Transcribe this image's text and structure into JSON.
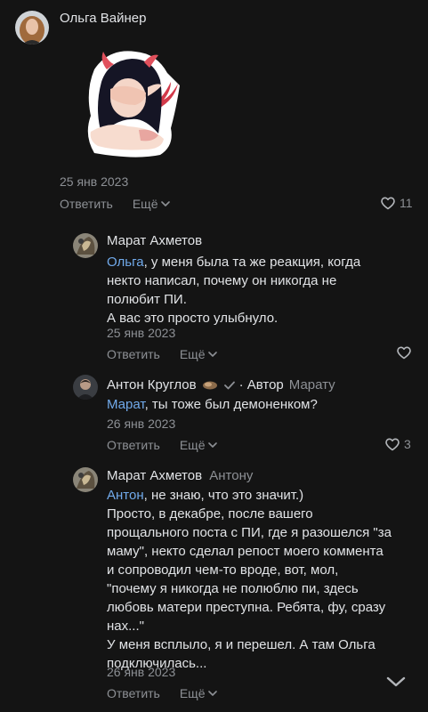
{
  "comments": [
    {
      "author": "Ольга Вайнер",
      "date": "25 янв 2023",
      "reply_label": "Ответить",
      "more_label": "Ещё",
      "likes": "11"
    },
    {
      "author": "Марат Ахметов",
      "mention": "Ольга",
      "lines": [
        ", у меня была та же реакция, когда",
        "некто написал, почему он никогда не",
        "полюбит ПИ.",
        "А вас это просто улыбнуло."
      ],
      "date": "25 янв 2023",
      "reply_label": "Ответить",
      "more_label": "Ещё"
    },
    {
      "author": "Антон Круглов",
      "author_role": "· Автор",
      "reply_to": "Марату",
      "mention": "Марат",
      "lines": [
        ", ты тоже был демоненком?"
      ],
      "date": "26 янв 2023",
      "reply_label": "Ответить",
      "more_label": "Ещё",
      "likes": "3"
    },
    {
      "author": "Марат Ахметов",
      "reply_to": "Антону",
      "mention": "Антон",
      "lines": [
        ", не знаю, что это значит.)",
        "Просто, в декабре, после вашего",
        "прощального поста с ПИ, где я разошелся \"за",
        "маму\", некто сделал репост моего коммента",
        "и сопроводил чем-то вроде, вот, мол,",
        "\"почему я никогда не полюблю пи, здесь",
        "любовь матери преступна. Ребята, фу, сразу",
        "нах...\"",
        "У меня всплыло, я и перешел. А там Ольга",
        "подключилась..."
      ],
      "date": "26 янв 2023",
      "reply_label": "Ответить",
      "more_label": "Ещё"
    }
  ],
  "colors": {
    "background": "#141414",
    "text": "#e1e3e6",
    "secondary": "#8d9095",
    "mention": "#71aaeb"
  }
}
